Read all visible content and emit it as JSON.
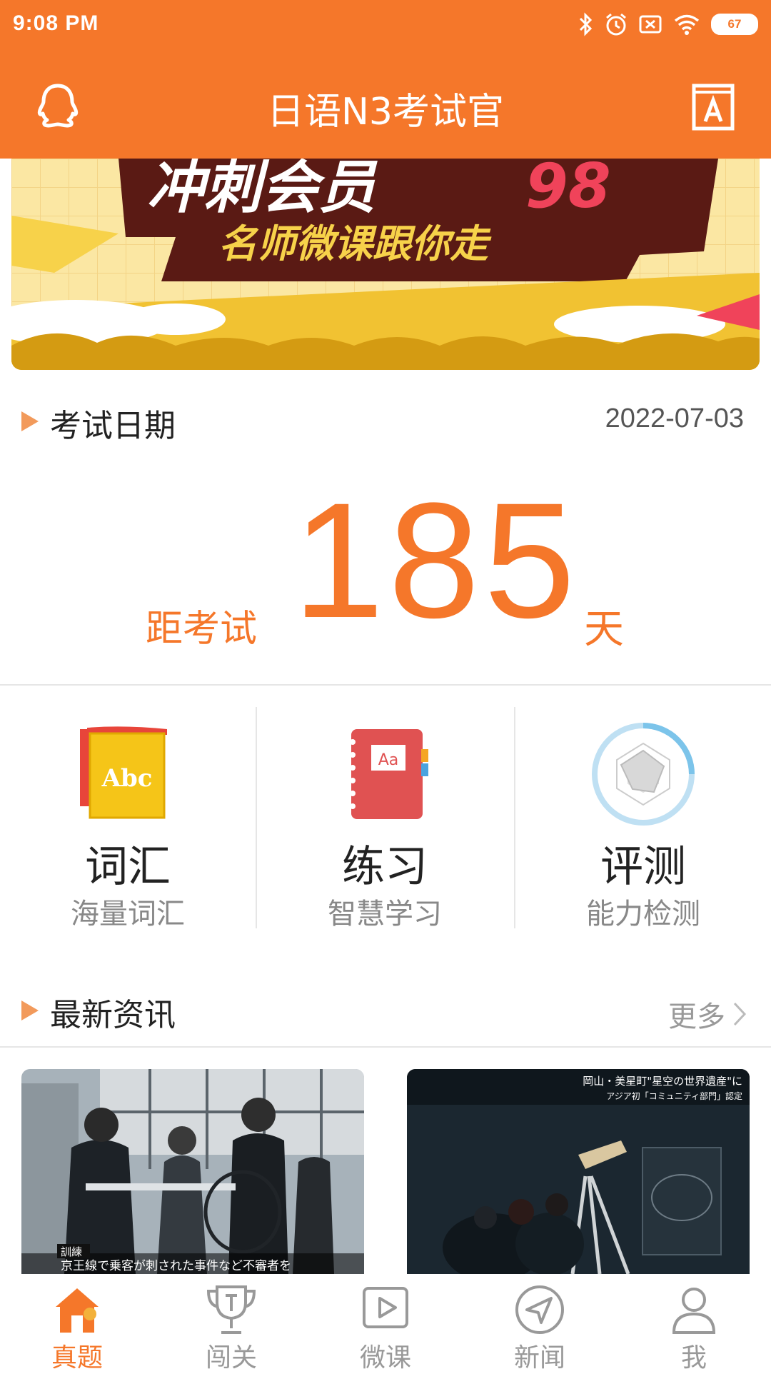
{
  "status_bar": {
    "time": "9:08 PM",
    "battery": "67"
  },
  "app_bar": {
    "title": "日语N3考试官"
  },
  "banner": {
    "headline_main": "冲刺会员",
    "headline_number": "98",
    "subline": "名师微课跟你走"
  },
  "exam": {
    "section_title": "考试日期",
    "date": "2022-07-03",
    "countdown_prefix": "距考试",
    "days": "185",
    "unit": "天"
  },
  "features": [
    {
      "title": "词汇",
      "subtitle": "海量词汇",
      "icon": "vocab-book-icon",
      "icon_text": "Abc"
    },
    {
      "title": "练习",
      "subtitle": "智慧学习",
      "icon": "notebook-icon",
      "icon_text": "Aa"
    },
    {
      "title": "评测",
      "subtitle": "能力检测",
      "icon": "radar-chart-icon"
    }
  ],
  "news": {
    "section_title": "最新资讯",
    "more_label": "更多",
    "cards": [
      {
        "caption": "京王線で乗客が刺された事件など不審者を",
        "tag": "訓練"
      },
      {
        "headline": "岡山・美星町\"星空の世界遺産\"に",
        "subheadline": "アジア初「コミュニティ部門」認定"
      }
    ]
  },
  "tabs": [
    {
      "label": "真题",
      "icon": "home-icon",
      "active": true
    },
    {
      "label": "闯关",
      "icon": "trophy-icon",
      "active": false
    },
    {
      "label": "微课",
      "icon": "play-icon",
      "active": false
    },
    {
      "label": "新闻",
      "icon": "send-icon",
      "active": false
    },
    {
      "label": "我",
      "icon": "person-icon",
      "active": false
    }
  ],
  "colors": {
    "primary": "#f5772a",
    "banner_bg": "#fbe7a3",
    "banner_ribbon": "#5a1a14",
    "highlight_red": "#f0435a"
  }
}
